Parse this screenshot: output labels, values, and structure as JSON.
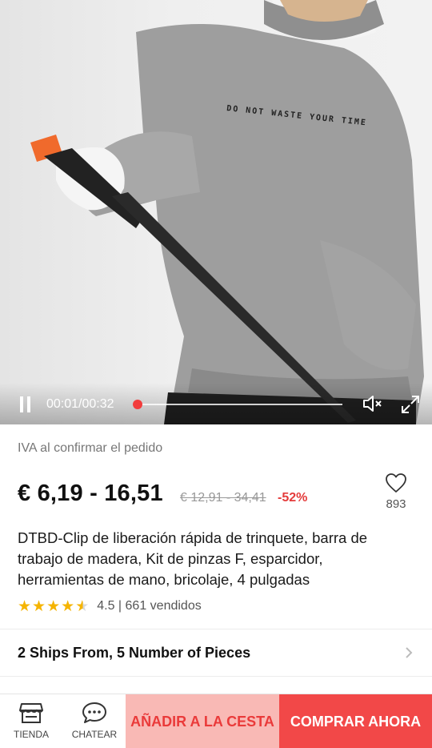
{
  "video": {
    "shirt_print": "DO NOT WASTE YOUR TIME",
    "time": "00:01/00:32",
    "progress": 0.03
  },
  "product": {
    "vat_note": "IVA al confirmar el pedido",
    "price": "€ 6,19 - 16,51",
    "old_price": "€ 12,91 - 34,41",
    "discount": "-52%",
    "wishlist_count": "893",
    "title": "DTBD-Clip de liberación rápida de trinquete, barra de trabajo de madera, Kit de pinzas F, esparcidor, herramientas de mano, bricolaje, 4 pulgadas",
    "rating": 4.5,
    "rating_text": "4.5 | 661 vendidos",
    "specs": "2 Ships From, 5 Number of Pieces"
  },
  "bottom_bar": {
    "store_label": "TIENDA",
    "chat_label": "CHATEAR",
    "add_to_cart": "AÑADIR A LA CESTA",
    "buy_now": "COMPRAR AHORA"
  },
  "colors": {
    "accent": "#f24848",
    "cart_bg": "#f9b9b5",
    "star": "#f5b400",
    "discount": "#e43b3b"
  },
  "icons": [
    "pause-icon",
    "mute-icon",
    "fullscreen-icon",
    "heart-icon",
    "star-icon",
    "chevron-right-icon",
    "store-icon",
    "chat-icon"
  ]
}
